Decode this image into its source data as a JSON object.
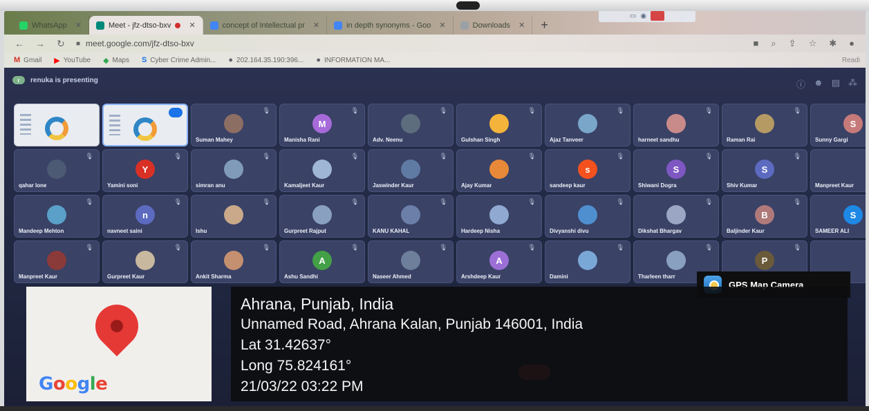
{
  "browser": {
    "tabs": [
      {
        "label": "WhatsApp",
        "color": "#25d366"
      },
      {
        "label": "Meet - jfz-dtso-bxv",
        "color": "#00897b",
        "active": true,
        "recording": true
      },
      {
        "label": "concept of Intellectual pr",
        "color": "#4285f4"
      },
      {
        "label": "in depth synonyms - Goo",
        "color": "#4285f4"
      },
      {
        "label": "Downloads",
        "color": "#9aa0a6"
      }
    ],
    "new_tab": "+",
    "url": "meet.google.com/jfz-dtso-bxv",
    "bookmarks": [
      {
        "label": "Gmail",
        "icon": "gmail-icon",
        "glyph": "M",
        "color": "#d93025"
      },
      {
        "label": "YouTube",
        "icon": "youtube-icon",
        "glyph": "▶",
        "color": "#ff0000"
      },
      {
        "label": "Maps",
        "icon": "maps-icon",
        "glyph": "◆",
        "color": "#34a853"
      },
      {
        "label": "Cyber Crime Admin...",
        "icon": "s-icon",
        "glyph": "S",
        "color": "#1a73e8"
      },
      {
        "label": "202.164.35.190:396...",
        "icon": "globe-icon",
        "glyph": "●",
        "color": "#5f6368"
      },
      {
        "label": "INFORMATION MA...",
        "icon": "globe-icon",
        "glyph": "●",
        "color": "#5f6368"
      }
    ],
    "reading_list": "Readi"
  },
  "meet": {
    "presenting_text": "renuka is presenting",
    "participants": [
      {
        "name": "",
        "type": "slide"
      },
      {
        "name": "",
        "type": "slide-active"
      },
      {
        "name": "Suman Mahey",
        "avatar_color": "#8d6e63",
        "initial": ""
      },
      {
        "name": "Manisha Rani",
        "avatar_color": "#a66ad9",
        "initial": "M"
      },
      {
        "name": "Adv. Neenu",
        "avatar_color": "#5d6d7e",
        "initial": ""
      },
      {
        "name": "Gulshan Singh",
        "avatar_color": "#f4b33a",
        "initial": ""
      },
      {
        "name": "Ajaz Tanveer",
        "avatar_color": "#7aa6c9",
        "initial": ""
      },
      {
        "name": "harneet sandhu",
        "avatar_color": "#c98a8a",
        "initial": ""
      },
      {
        "name": "Raman Rai",
        "avatar_color": "#b59a64",
        "initial": ""
      },
      {
        "name": "Sunny Gargi",
        "avatar_color": "#c77a7a",
        "initial": "S"
      },
      {
        "name": "qahar lone",
        "avatar_color": "#4d5a74",
        "initial": ""
      },
      {
        "name": "Yamini soni",
        "avatar_color": "#d93025",
        "initial": "Y"
      },
      {
        "name": "simran anu",
        "avatar_color": "#7f9bb9",
        "initial": ""
      },
      {
        "name": "Kamaljeet Kaur",
        "avatar_color": "#9fb6d4",
        "initial": ""
      },
      {
        "name": "Jaswinder Kaur",
        "avatar_color": "#5f7ba3",
        "initial": ""
      },
      {
        "name": "Ajay Kumar",
        "avatar_color": "#e8893a",
        "initial": ""
      },
      {
        "name": "sandeep kaur",
        "avatar_color": "#f4511e",
        "initial": "s"
      },
      {
        "name": "Shiwani Dogra",
        "avatar_color": "#7e57c2",
        "initial": "S"
      },
      {
        "name": "Shiv Kumar",
        "avatar_color": "#5c6bc0",
        "initial": "S"
      },
      {
        "name": "Manpreet Kaur",
        "avatar_color": "#3a4266",
        "initial": ""
      },
      {
        "name": "Mandeep Mehton",
        "avatar_color": "#5aa0c8",
        "initial": ""
      },
      {
        "name": "navneet saini",
        "avatar_color": "#5c6bc0",
        "initial": "n"
      },
      {
        "name": "Ishu",
        "avatar_color": "#c9a98a",
        "initial": ""
      },
      {
        "name": "Gurpreet Rajput",
        "avatar_color": "#8aa0c0",
        "initial": ""
      },
      {
        "name": "KANU KAHAL",
        "avatar_color": "#6b7fa8",
        "initial": ""
      },
      {
        "name": "Hardeep Nisha",
        "avatar_color": "#8fa9d0",
        "initial": ""
      },
      {
        "name": "Divyanshi divu",
        "avatar_color": "#4f8fd0",
        "initial": ""
      },
      {
        "name": "Dikshat Bhargav",
        "avatar_color": "#9aa6c4",
        "initial": ""
      },
      {
        "name": "Baljinder Kaur",
        "avatar_color": "#b07a7a",
        "initial": "B"
      },
      {
        "name": "SAMEER ALI",
        "avatar_color": "#1e88e5",
        "initial": "S"
      },
      {
        "name": "Manpreet Kaur",
        "avatar_color": "#8b3a3a",
        "initial": ""
      },
      {
        "name": "Gurpreet Kaur",
        "avatar_color": "#c8b8a0",
        "initial": ""
      },
      {
        "name": "Ankit Sharma",
        "avatar_color": "#c49070",
        "initial": ""
      },
      {
        "name": "Ashu Sandhi",
        "avatar_color": "#43a047",
        "initial": "A"
      },
      {
        "name": "Naseer Ahmed",
        "avatar_color": "#6d7f9a",
        "initial": ""
      },
      {
        "name": "Arshdeep Kaur",
        "avatar_color": "#9c6fd6",
        "initial": "A"
      },
      {
        "name": "Damini",
        "avatar_color": "#7aa8d6",
        "initial": ""
      },
      {
        "name": "Tharleen tharr",
        "avatar_color": "#8aa0c0",
        "initial": ""
      },
      {
        "name": "",
        "avatar_color": "#6b5a3a",
        "initial": "P"
      },
      {
        "name": "",
        "avatar_color": "#3a4266",
        "initial": ""
      }
    ]
  },
  "gps": {
    "app_name": "GPS Map Camera",
    "map_brand": [
      "G",
      "o",
      "o",
      "g",
      "l",
      "e"
    ],
    "location_title": "Ahrana, Punjab, India",
    "address": "Unnamed Road, Ahrana Kalan, Punjab 146001, India",
    "lat": "Lat 31.42637°",
    "long": "Long 75.824161°",
    "datetime": "21/03/22 03:22 PM"
  }
}
